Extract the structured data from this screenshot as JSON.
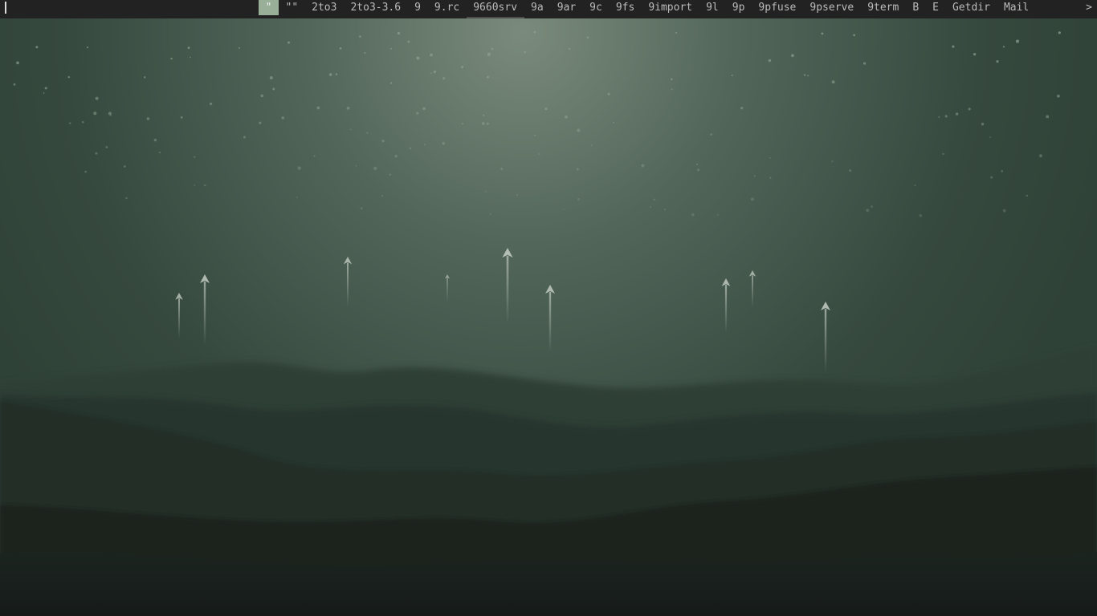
{
  "menubar": {
    "prompt_value": "",
    "items": [
      {
        "label": "\"",
        "selected": true
      },
      {
        "label": "\"\""
      },
      {
        "label": "2to3"
      },
      {
        "label": "2to3-3.6"
      },
      {
        "label": "9"
      },
      {
        "label": "9.rc"
      },
      {
        "label": "9660srv"
      },
      {
        "label": "9a"
      },
      {
        "label": "9ar"
      },
      {
        "label": "9c"
      },
      {
        "label": "9fs"
      },
      {
        "label": "9import"
      },
      {
        "label": "9l"
      },
      {
        "label": "9p"
      },
      {
        "label": "9pfuse"
      },
      {
        "label": "9pserve"
      },
      {
        "label": "9term"
      },
      {
        "label": "B"
      },
      {
        "label": "E"
      },
      {
        "label": "Getdir"
      },
      {
        "label": "Mail"
      }
    ],
    "more_indicator": ">",
    "colors": {
      "bar_background": "#222222",
      "text": "#bbbbbb",
      "selected_background": "#9aaf98"
    }
  },
  "wallpaper": {
    "description_icon": "misty-mountains-rockets-wallpaper",
    "colors": {
      "sky_glow": "#7a8b7c",
      "sky": "#3b5244",
      "hills_far": "#2b3d33",
      "hills_near": "#1a201d"
    }
  }
}
